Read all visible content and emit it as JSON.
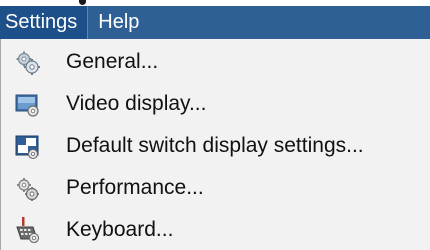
{
  "menubar": {
    "items": [
      {
        "label": "Settings",
        "active": true
      },
      {
        "label": "Help",
        "active": false
      }
    ]
  },
  "menu": {
    "items": [
      {
        "label": "General...",
        "icon": "gears-icon"
      },
      {
        "label": "Video display...",
        "icon": "video-display-icon"
      },
      {
        "label": "Default switch display settings...",
        "icon": "switch-display-icon"
      },
      {
        "label": "Performance...",
        "icon": "performance-icon"
      },
      {
        "label": "Keyboard...",
        "icon": "keyboard-icon"
      }
    ]
  },
  "colors": {
    "menubar_bg": "#2e5f95",
    "menubar_active_bg": "#1d4f88",
    "menu_bg": "#f2f2f2"
  }
}
